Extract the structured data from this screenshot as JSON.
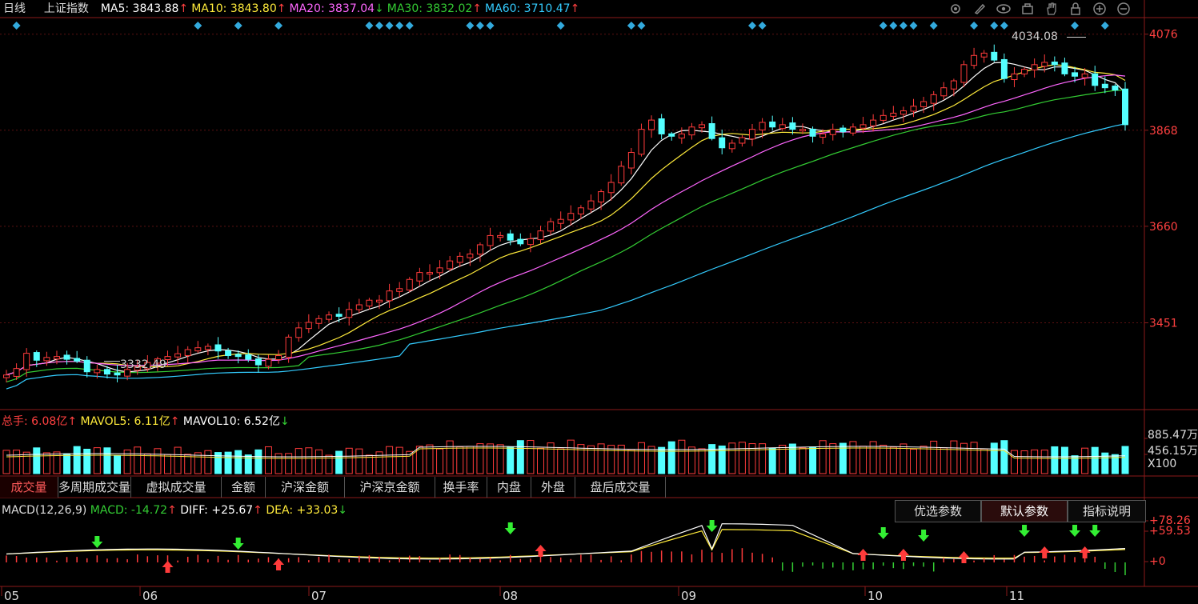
{
  "header": {
    "period": "日线",
    "index_name": "上证指数",
    "ma": [
      {
        "label": "MA5: ",
        "value": "3843.88",
        "arrow": "↑",
        "color": "#ffffff"
      },
      {
        "label": "MA10: ",
        "value": "3843.80",
        "arrow": "↑",
        "color": "#ffeb3b"
      },
      {
        "label": "MA20: ",
        "value": "3837.04",
        "arrow": "↓",
        "color": "#ff66ff"
      },
      {
        "label": "MA30: ",
        "value": "3832.02",
        "arrow": "↑",
        "color": "#33cc33"
      },
      {
        "label": "MA60: ",
        "value": "3710.47",
        "arrow": "↑",
        "color": "#33ccff"
      }
    ]
  },
  "toolbar_icons": [
    "settings-icon",
    "draw-icon",
    "eye-icon",
    "briefcase-icon",
    "hand-icon",
    "lock-icon",
    "zoom-in-icon",
    "zoom-out-icon"
  ],
  "price_axis": {
    "labels": [
      "4076",
      "3868",
      "3660",
      "3451"
    ],
    "values": [
      4076,
      3868,
      3660,
      3451
    ]
  },
  "annotations": {
    "high": "4034.08",
    "low": "3332.49"
  },
  "volume_header": {
    "total_label": "总手: ",
    "total_value": "6.08亿",
    "total_arrow": "↑",
    "mavol5_label": "MAVOL5: ",
    "mavol5_value": "6.11亿",
    "mavol5_arrow": "↑",
    "mavol10_label": "MAVOL10: ",
    "mavol10_value": "6.52亿",
    "mavol10_arrow": "↓"
  },
  "volume_axis": {
    "top": "885.47万",
    "mid": "456.15万",
    "unit": "X100"
  },
  "tabs": [
    "成交量",
    "多周期成交量",
    "虚拟成交量",
    "金额",
    "沪深金额",
    "沪深京金额",
    "换手率",
    "内盘",
    "外盘",
    "盘后成交量"
  ],
  "macd_header": {
    "name": "MACD(12,26,9)",
    "macd_label": "MACD: ",
    "macd_value": "-14.72",
    "macd_arrow": "↑",
    "diff_label": "DIFF: ",
    "diff_value": "+25.67",
    "diff_arrow": "↑",
    "dea_label": "DEA: ",
    "dea_value": "+33.03",
    "dea_arrow": "↓"
  },
  "macd_buttons": [
    "优选参数",
    "默认参数",
    "指标说明"
  ],
  "macd_axis": {
    "labels": [
      "+78.26",
      "+59.53",
      "+0"
    ]
  },
  "date_axis": [
    "05",
    "06",
    "07",
    "08",
    "09",
    "10",
    "11"
  ],
  "chart_data": {
    "type": "candlestick",
    "y_range": [
      3270,
      4105
    ],
    "closes": [
      3338,
      3352,
      3385,
      3370,
      3376,
      3378,
      3372,
      3368,
      3345,
      3350,
      3340,
      3338,
      3350,
      3355,
      3365,
      3373,
      3378,
      3384,
      3393,
      3397,
      3400,
      3390,
      3380,
      3378,
      3372,
      3360,
      3372,
      3380,
      3420,
      3440,
      3452,
      3460,
      3468,
      3465,
      3480,
      3490,
      3500,
      3500,
      3520,
      3525,
      3545,
      3560,
      3560,
      3570,
      3585,
      3595,
      3600,
      3620,
      3640,
      3640,
      3630,
      3622,
      3633,
      3650,
      3670,
      3675,
      3688,
      3700,
      3715,
      3735,
      3755,
      3790,
      3820,
      3870,
      3890,
      3860,
      3855,
      3860,
      3875,
      3880,
      3850,
      3830,
      3840,
      3852,
      3870,
      3885,
      3875,
      3880,
      3870,
      3870,
      3855,
      3860,
      3870,
      3865,
      3875,
      3880,
      3890,
      3900,
      3905,
      3910,
      3920,
      3930,
      3945,
      3960,
      3975,
      4010,
      4030,
      4035,
      4020,
      3980,
      3990,
      4000,
      4010,
      4015,
      4010,
      3990,
      3985,
      3990,
      3965,
      3960,
      3955,
      3880
    ]
  }
}
